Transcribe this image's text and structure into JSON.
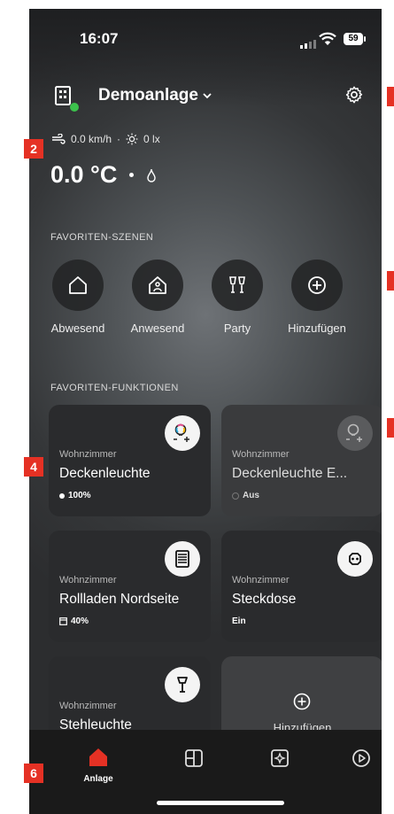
{
  "status": {
    "time": "16:07",
    "battery": "59"
  },
  "header": {
    "site_name": "Demoanlage"
  },
  "weather": {
    "wind": "0.0 km/h",
    "separator": "·",
    "light": "0 lx",
    "temperature": "0.0 °C"
  },
  "scenes": {
    "title": "FAVORITEN-SZENEN",
    "items": [
      {
        "label": "Abwesend",
        "icon": "house-outline-icon"
      },
      {
        "label": "Anwesend",
        "icon": "house-person-icon"
      },
      {
        "label": "Party",
        "icon": "cheers-glasses-icon"
      },
      {
        "label": "Hinzufügen",
        "icon": "plus-circle-icon"
      }
    ]
  },
  "functions": {
    "title": "FAVORITEN-FUNKTIONEN",
    "items": [
      {
        "room": "Wohnzimmer",
        "name": "Deckenleuchte",
        "value": "100%",
        "icon": "color-bulb-icon"
      },
      {
        "room": "Wohnzimmer",
        "name": "Deckenleuchte E...",
        "value": "Aus",
        "icon": "color-bulb-icon"
      },
      {
        "room": "Wohnzimmer",
        "name": "Rollladen Nordseite",
        "value": "40%",
        "icon": "blind-icon"
      },
      {
        "room": "Wohnzimmer",
        "name": "Steckdose",
        "value": "Ein",
        "icon": "socket-icon"
      },
      {
        "room": "Wohnzimmer",
        "name": "Stehleuchte",
        "value": "",
        "icon": "floor-lamp-icon"
      },
      {
        "room": "",
        "name": "Hinzufügen",
        "value": "",
        "icon": "plus-circle-icon"
      }
    ]
  },
  "tabbar": {
    "items": [
      {
        "label": "Anlage",
        "icon": "home-icon",
        "active": true
      },
      {
        "label": "",
        "icon": "rooms-icon"
      },
      {
        "label": "",
        "icon": "scenes-icon"
      },
      {
        "label": "",
        "icon": "play-icon"
      }
    ]
  },
  "markers": [
    "2",
    "4",
    "6"
  ],
  "colors": {
    "accent": "#e53124",
    "marker": "#e53124",
    "online": "#3cc24c"
  }
}
